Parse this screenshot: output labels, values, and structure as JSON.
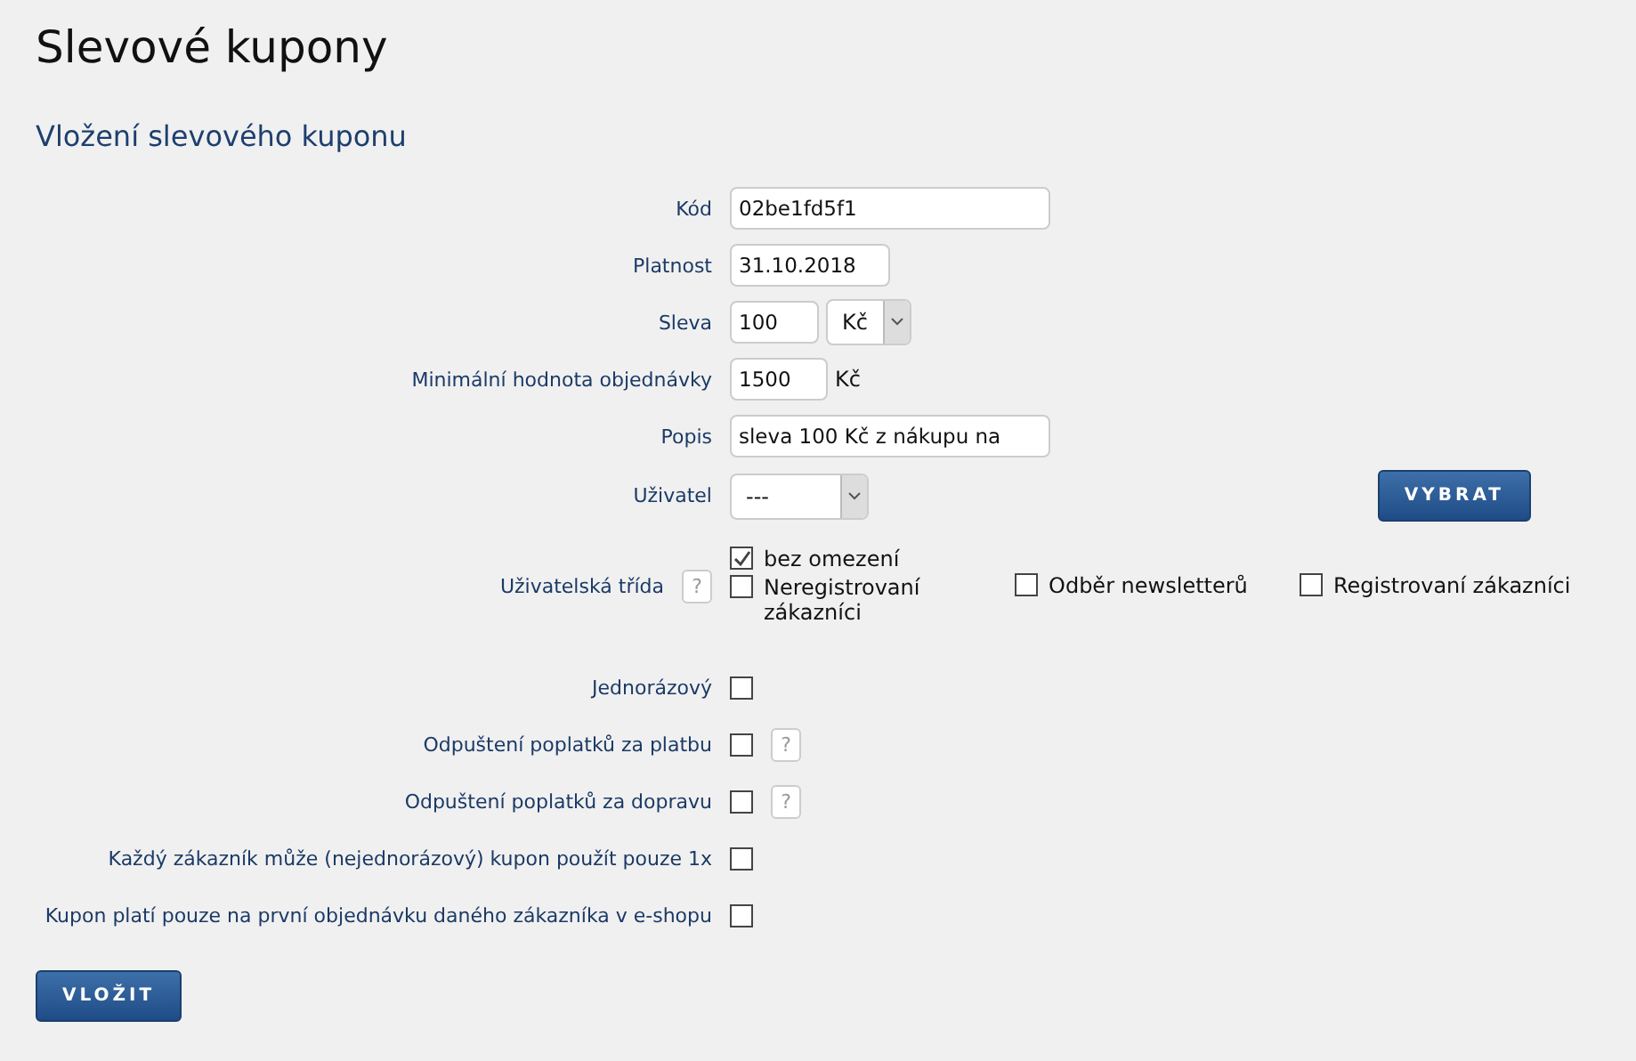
{
  "title": "Slevové kupony",
  "subtitle": "Vložení slevového kuponu",
  "fields": [
    {
      "kind": "text",
      "label": "Kód",
      "value": "02be1fd5f1"
    },
    {
      "kind": "date",
      "label": "Platnost",
      "value": "31.10.2018"
    },
    {
      "kind": "discount",
      "label": "Sleva",
      "value": "100",
      "unit_select": "Kč"
    },
    {
      "kind": "amount",
      "label": "Minimální hodnota objednávky",
      "value": "1500",
      "unit": "Kč"
    },
    {
      "kind": "text",
      "label": "Popis",
      "value": "sleva 100 Kč z nákupu na"
    },
    {
      "kind": "user",
      "label": "Uživatel",
      "select": "---",
      "button": "VYBRAT"
    }
  ],
  "user_class": {
    "label": "Uživatelská třída",
    "help": "?",
    "options": [
      {
        "label": "bez omezení",
        "checked": true
      },
      {
        "label": "Neregistrovaní zákazníci",
        "checked": false
      },
      {
        "label": "Odběr newsletterů",
        "checked": false
      },
      {
        "label": "Registrovaní zákazníci",
        "checked": false
      }
    ]
  },
  "checkboxes": [
    {
      "label": "Jednorázový",
      "checked": false
    },
    {
      "label": "Odpuštení poplatků za platbu",
      "checked": false,
      "help": "?"
    },
    {
      "label": "Odpuštení poplatků za dopravu",
      "checked": false,
      "help": "?"
    },
    {
      "label": "Každý zákazník může (nejednorázový) kupon použít pouze 1x",
      "checked": false
    },
    {
      "label": "Kupon platí pouze na první objednávku daného zákazníka v e-shopu",
      "checked": false
    }
  ],
  "submit": "VLOŽIT"
}
